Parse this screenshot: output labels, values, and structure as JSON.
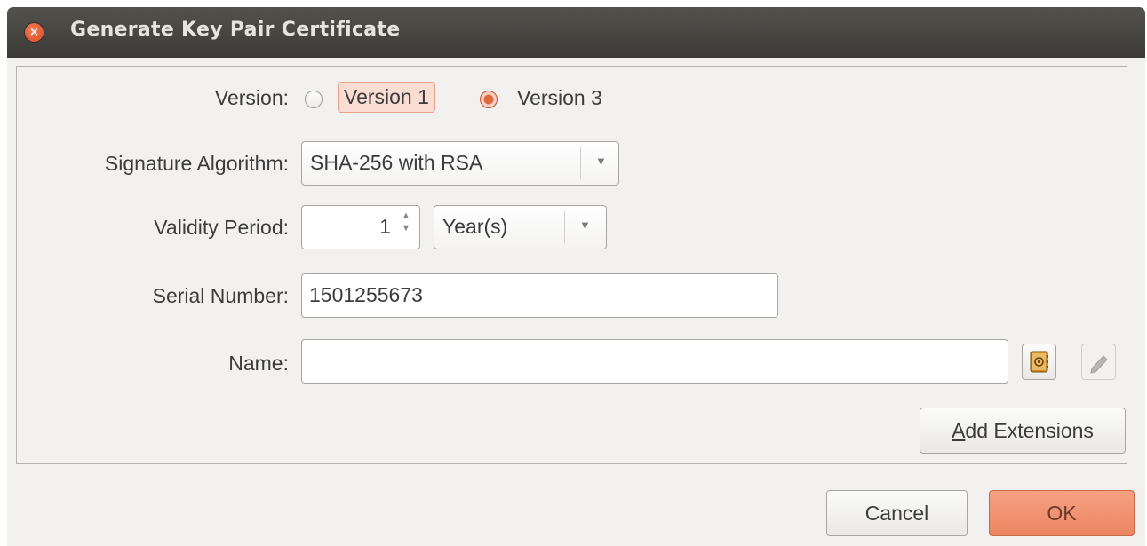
{
  "window": {
    "title": "Generate Key Pair Certificate"
  },
  "form": {
    "version_label": "Version:",
    "version_options": [
      "Version 1",
      "Version 3"
    ],
    "version_selected": "Version 3",
    "signature_algorithm_label": "Signature Algorithm:",
    "signature_algorithm_value": "SHA-256 with RSA",
    "validity_period_label": "Validity Period:",
    "validity_period_value": "1",
    "validity_period_unit": "Year(s)",
    "serial_number_label": "Serial Number:",
    "serial_number_value": "1501255673",
    "name_label": "Name:",
    "name_value": "",
    "add_extensions_label": "Add Extensions",
    "add_extensions_mnemonic": "A",
    "add_extensions_rest": "dd Extensions"
  },
  "buttons": {
    "cancel": "Cancel",
    "ok": "OK"
  },
  "colors": {
    "accent": "#ec8560",
    "titlebar": "#3c3b37",
    "background": "#f2f1f0"
  }
}
